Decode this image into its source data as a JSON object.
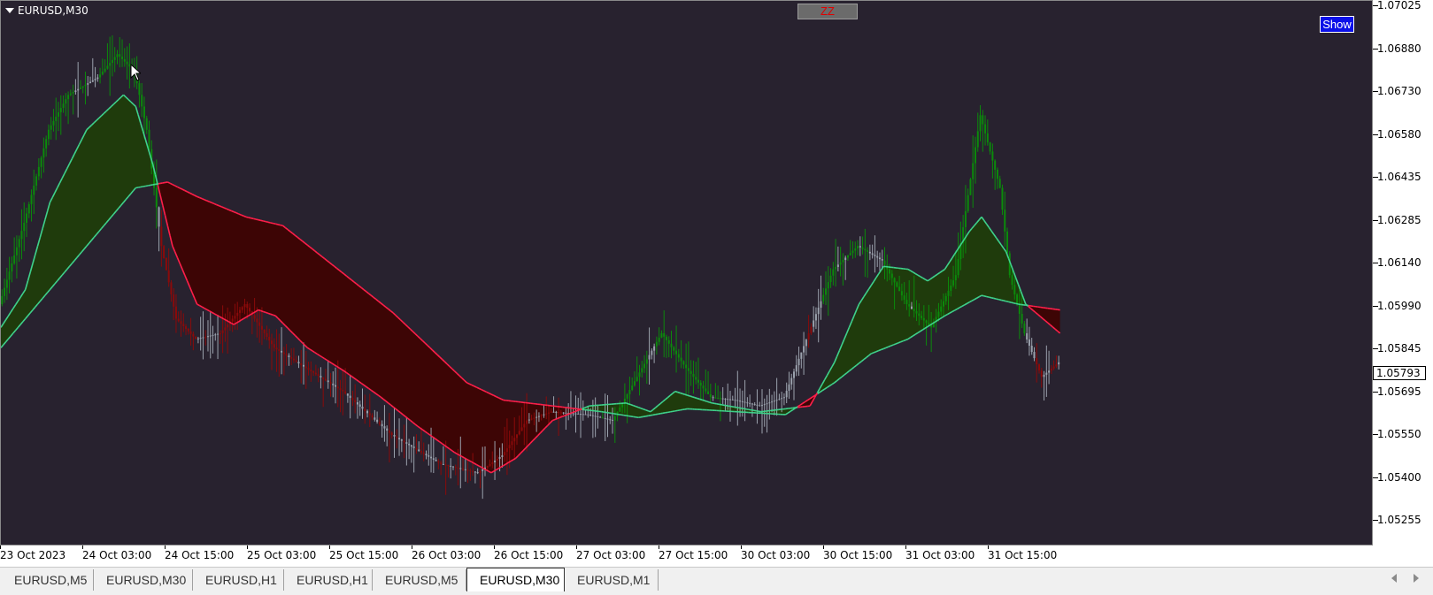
{
  "window": {
    "title": "EURUSD,M30"
  },
  "buttons": {
    "zz": "ZZ",
    "show": "Show"
  },
  "price_scale": {
    "labels": [
      "1.07025",
      "1.06880",
      "1.06730",
      "1.06580",
      "1.06435",
      "1.06285",
      "1.06140",
      "1.05990",
      "1.05845",
      "1.05695",
      "1.05550",
      "1.05400",
      "1.05255"
    ],
    "current_price": "1.05793"
  },
  "time_axis": {
    "labels": [
      "23 Oct 2023",
      "24 Oct 03:00",
      "24 Oct 15:00",
      "25 Oct 03:00",
      "25 Oct 15:00",
      "26 Oct 03:00",
      "26 Oct 15:00",
      "27 Oct 03:00",
      "27 Oct 15:00",
      "30 Oct 03:00",
      "30 Oct 15:00",
      "31 Oct 03:00",
      "31 Oct 15:00"
    ]
  },
  "tabs": [
    {
      "label": "EURUSD,M5",
      "active": false
    },
    {
      "label": "EURUSD,M30",
      "active": false
    },
    {
      "label": "EURUSD,H1",
      "active": false
    },
    {
      "label": "EURUSD,H1",
      "active": false
    },
    {
      "label": "EURUSD,M5",
      "active": false
    },
    {
      "label": "EURUSD,M30",
      "active": true
    },
    {
      "label": "EURUSD,M1",
      "active": false
    }
  ],
  "colors": {
    "background": "#28222f",
    "bull_candle": "#0b8a0b",
    "bear_candle": "#8b0a0a",
    "neutral_candle": "#9ba2ad",
    "fast_ma": "#3fd28c",
    "slow_ma_bull": "#3fd28c",
    "slow_ma_bear": "#ff1f4a",
    "bull_fill": "#1f3b0c",
    "bear_fill": "#3d0505"
  },
  "icons": {
    "menu": "triangle-down-icon",
    "cursor": "mouse-cursor-icon",
    "scroll_left": "scroll-left-icon",
    "scroll_right": "scroll-right-icon"
  },
  "chart_data": {
    "type": "candlestick",
    "symbol": "EURUSD",
    "timeframe": "M30",
    "ylim": [
      1.052,
      1.0705
    ],
    "x_ticks": [
      "23 Oct 2023",
      "24 Oct 03:00",
      "24 Oct 15:00",
      "25 Oct 03:00",
      "25 Oct 15:00",
      "26 Oct 03:00",
      "26 Oct 15:00",
      "27 Oct 03:00",
      "27 Oct 15:00",
      "30 Oct 03:00",
      "30 Oct 15:00",
      "31 Oct 03:00",
      "31 Oct 15:00"
    ],
    "close_path": [
      [
        0,
        1.06
      ],
      [
        10,
        1.0628
      ],
      [
        20,
        1.066
      ],
      [
        28,
        1.0672
      ],
      [
        40,
        1.0678
      ],
      [
        48,
        1.0686
      ],
      [
        55,
        1.068
      ],
      [
        60,
        1.066
      ],
      [
        66,
        1.062
      ],
      [
        72,
        1.0595
      ],
      [
        80,
        1.0588
      ],
      [
        90,
        1.059
      ],
      [
        100,
        1.06
      ],
      [
        112,
        1.0585
      ],
      [
        125,
        1.0578
      ],
      [
        140,
        1.057
      ],
      [
        160,
        1.0555
      ],
      [
        180,
        1.0545
      ],
      [
        195,
        1.0542
      ],
      [
        205,
        1.0548
      ],
      [
        215,
        1.056
      ],
      [
        225,
        1.0563
      ],
      [
        240,
        1.0562
      ],
      [
        250,
        1.056
      ],
      [
        260,
        1.0575
      ],
      [
        270,
        1.059
      ],
      [
        280,
        1.0578
      ],
      [
        290,
        1.0568
      ],
      [
        300,
        1.0567
      ],
      [
        310,
        1.0565
      ],
      [
        320,
        1.0568
      ],
      [
        330,
        1.059
      ],
      [
        340,
        1.0612
      ],
      [
        350,
        1.062
      ],
      [
        360,
        1.0615
      ],
      [
        370,
        1.06
      ],
      [
        380,
        1.0592
      ],
      [
        390,
        1.061
      ],
      [
        400,
        1.0665
      ],
      [
        408,
        1.064
      ],
      [
        412,
        1.061
      ],
      [
        418,
        1.059
      ],
      [
        425,
        1.0575
      ],
      [
        432,
        1.058
      ]
    ],
    "fast_ma": [
      [
        0,
        1.0592
      ],
      [
        10,
        1.0605
      ],
      [
        20,
        1.0635
      ],
      [
        35,
        1.066
      ],
      [
        50,
        1.0672
      ],
      [
        55,
        1.0668
      ],
      [
        62,
        1.0648
      ],
      [
        70,
        1.062
      ],
      [
        80,
        1.06
      ],
      [
        95,
        1.0593
      ],
      [
        105,
        1.0598
      ],
      [
        112,
        1.0596
      ],
      [
        125,
        1.0585
      ],
      [
        140,
        1.0577
      ],
      [
        155,
        1.0568
      ],
      [
        170,
        1.0558
      ],
      [
        185,
        1.0549
      ],
      [
        200,
        1.0542
      ],
      [
        210,
        1.0547
      ],
      [
        225,
        1.056
      ],
      [
        240,
        1.0565
      ],
      [
        255,
        1.0566
      ],
      [
        265,
        1.0563
      ],
      [
        275,
        1.057
      ],
      [
        290,
        1.0566
      ],
      [
        310,
        1.0563
      ],
      [
        330,
        1.0565
      ],
      [
        340,
        1.058
      ],
      [
        350,
        1.06
      ],
      [
        360,
        1.0613
      ],
      [
        370,
        1.0612
      ],
      [
        378,
        1.0608
      ],
      [
        385,
        1.0612
      ],
      [
        395,
        1.0625
      ],
      [
        400,
        1.063
      ],
      [
        410,
        1.0618
      ],
      [
        418,
        1.06
      ],
      [
        432,
        1.059
      ]
    ],
    "slow_ma": [
      [
        0,
        1.0585
      ],
      [
        20,
        1.0605
      ],
      [
        40,
        1.0625
      ],
      [
        55,
        1.064
      ],
      [
        68,
        1.0642
      ],
      [
        80,
        1.0637
      ],
      [
        100,
        1.063
      ],
      [
        115,
        1.0627
      ],
      [
        130,
        1.0617
      ],
      [
        145,
        1.0607
      ],
      [
        160,
        1.0597
      ],
      [
        175,
        1.0585
      ],
      [
        190,
        1.0573
      ],
      [
        205,
        1.0567
      ],
      [
        225,
        1.0565
      ],
      [
        245,
        1.0563
      ],
      [
        260,
        1.0561
      ],
      [
        280,
        1.0564
      ],
      [
        300,
        1.0563
      ],
      [
        320,
        1.0562
      ],
      [
        340,
        1.0573
      ],
      [
        355,
        1.0583
      ],
      [
        370,
        1.0588
      ],
      [
        385,
        1.0596
      ],
      [
        400,
        1.0603
      ],
      [
        415,
        1.06
      ],
      [
        432,
        1.0598
      ]
    ],
    "bar_count": 432
  }
}
